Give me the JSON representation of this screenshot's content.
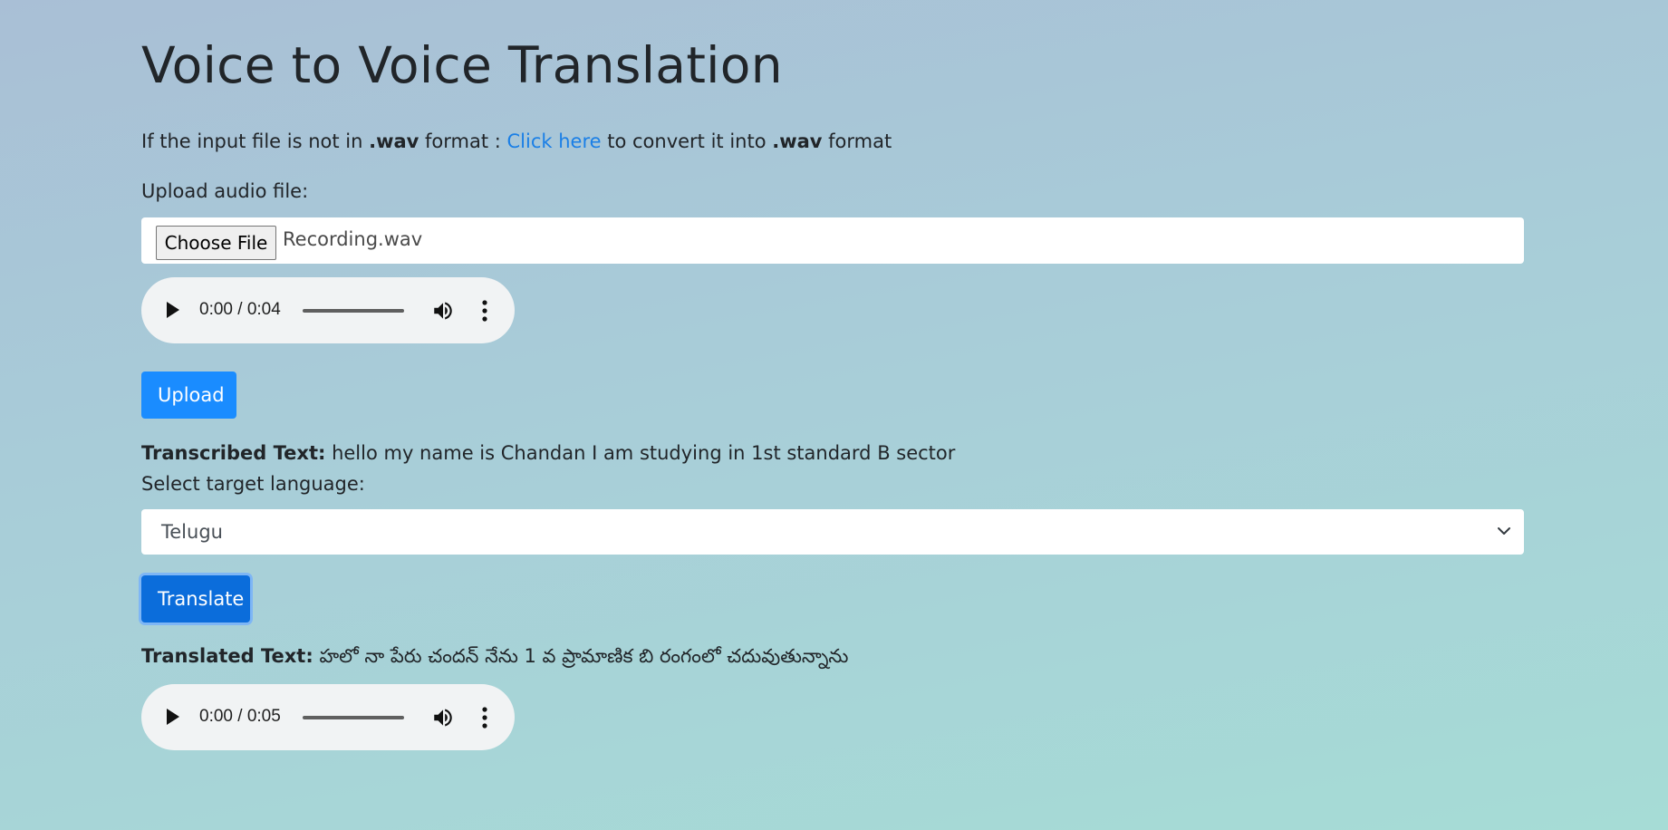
{
  "page": {
    "title": "Voice to Voice Translation"
  },
  "info": {
    "prefix": "If the input file is not in ",
    "format1": ".wav",
    "middle": " format : ",
    "link": "Click here",
    "after_link": " to convert it into ",
    "format2": ".wav",
    "suffix": " format"
  },
  "upload": {
    "label": "Upload audio file:",
    "choose_button": "Choose File",
    "file_name": "Recording.wav",
    "button": "Upload"
  },
  "input_audio": {
    "time": "0:00 / 0:04"
  },
  "transcription": {
    "label": "Transcribed Text:",
    "text": "hello my name is Chandan I am studying in 1st standard B sector"
  },
  "language": {
    "label": "Select target language:",
    "selected": "Telugu"
  },
  "translate": {
    "button": "Translate"
  },
  "translation": {
    "label": "Translated Text:",
    "text": "హలో నా పేరు చందన్ నేను 1 వ ప్రామాణిక బి రంగంలో చదువుతున్నాను"
  },
  "output_audio": {
    "time": "0:00 / 0:05"
  },
  "icons": {
    "play": "play-icon",
    "volume": "volume-icon",
    "more": "more-vertical-icon",
    "chevron": "chevron-down-icon"
  },
  "colors": {
    "primary": "#1a8cff",
    "link": "#1a7fe6"
  }
}
